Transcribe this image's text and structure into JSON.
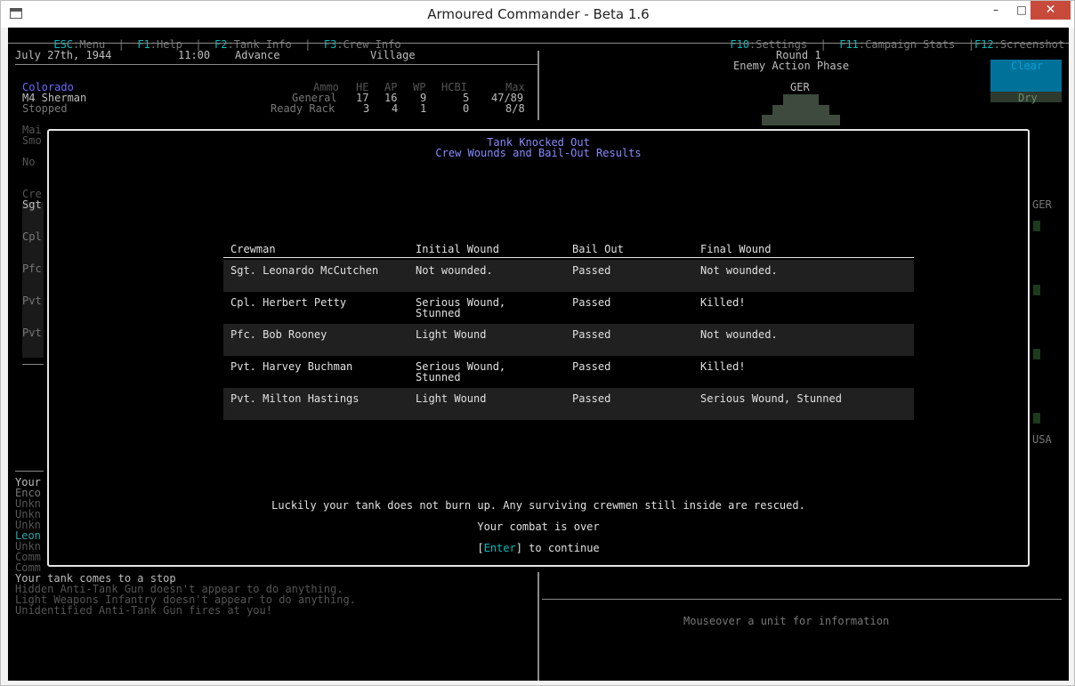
{
  "window": {
    "title": "Armoured Commander - Beta 1.6",
    "minimize": "–",
    "maximize": "□",
    "close": "✕"
  },
  "menu": {
    "items": [
      {
        "key": "ESC",
        "label": ":Menu"
      },
      {
        "key": "F1",
        "label": ":Help"
      },
      {
        "key": "F2",
        "label": ":Tank Info"
      },
      {
        "key": "F3",
        "label": ":Crew Info"
      }
    ],
    "separator": "|",
    "right_items": [
      {
        "key": "F10",
        "label": ":Settings"
      },
      {
        "key": "F11",
        "label": ":Campaign Stats"
      },
      {
        "key": "F12",
        "label": ":Screenshot"
      }
    ]
  },
  "status": {
    "date": "July 27th, 1944",
    "time": "11:00",
    "mission": "Advance",
    "terrain": "Village"
  },
  "tank": {
    "name": "Colorado",
    "model": "M4 Sherman",
    "state": "Stopped"
  },
  "ammo": {
    "headers": [
      "Ammo",
      "HE",
      "AP",
      "WP",
      "HCBI",
      "Max"
    ],
    "rows": [
      {
        "label": "General",
        "he": "17",
        "ap": "16",
        "wp": "9",
        "hcbi": "5",
        "max": "47/89"
      },
      {
        "label": "Ready Rack",
        "he": "3",
        "ap": "4",
        "wp": "1",
        "hcbi": "0",
        "max": "8/8"
      }
    ]
  },
  "left_fragments": {
    "a": "Mai",
    "b": "Smo",
    "c": "No",
    "d": "Cre",
    "e": "Sgt",
    "f": "Cpl",
    "g": "Pfc",
    "h": "Pvt",
    "i": "Pvt"
  },
  "log_fragments": [
    "Your",
    "Enco",
    "Unkn",
    "Unkn",
    "Unkn",
    "Leon",
    "Unkn",
    "Comm",
    "Comm"
  ],
  "phase": {
    "round": "Round 1",
    "phase": "Enemy Action Phase"
  },
  "weather": {
    "sky": "Clear",
    "ground": "Dry"
  },
  "map": {
    "ger_label_top": "GER",
    "ger_label_side": "GER",
    "usa_label": "USA"
  },
  "messages": [
    "Your tank comes to a stop",
    "Hidden Anti-Tank Gun doesn't appear to do anything.",
    "Light Weapons Infantry doesn't appear to do anything.",
    "Unidentified Anti-Tank Gun fires at you!"
  ],
  "info_panel": {
    "text": "Mouseover a unit for information"
  },
  "modal": {
    "title": "Tank Knocked Out",
    "subtitle": "Crew Wounds and Bail-Out Results",
    "headers": [
      "Crewman",
      "Initial Wound",
      "Bail Out",
      "Final Wound"
    ],
    "crew": [
      {
        "name": "Sgt. Leonardo McCutchen",
        "initial": "Not wounded.",
        "initial2": "",
        "bail": "Passed",
        "final": "Not wounded."
      },
      {
        "name": "Cpl. Herbert Petty",
        "initial": "Serious Wound,",
        "initial2": "Stunned",
        "bail": "Passed",
        "final": "Killed!"
      },
      {
        "name": "Pfc. Bob Rooney",
        "initial": "Light Wound",
        "initial2": "",
        "bail": "Passed",
        "final": "Not wounded."
      },
      {
        "name": "Pvt. Harvey Buchman",
        "initial": "Serious Wound,",
        "initial2": "Stunned",
        "bail": "Passed",
        "final": "Killed!"
      },
      {
        "name": "Pvt. Milton Hastings",
        "initial": "Light Wound",
        "initial2": "",
        "bail": "Passed",
        "final": "Serious Wound, Stunned"
      }
    ],
    "outcome": "Luckily your tank does not burn up. Any surviving crewmen still inside are rescued.",
    "combat_over": "Your combat is over",
    "enter_open": "[",
    "enter_key": "Enter",
    "enter_close": "] to continue"
  },
  "colors": {
    "wound_red": "#ff2a2a",
    "key_cyan": "#00bcbc",
    "title_blue": "#8a8aff",
    "tank_blue": "#6a6aff"
  }
}
